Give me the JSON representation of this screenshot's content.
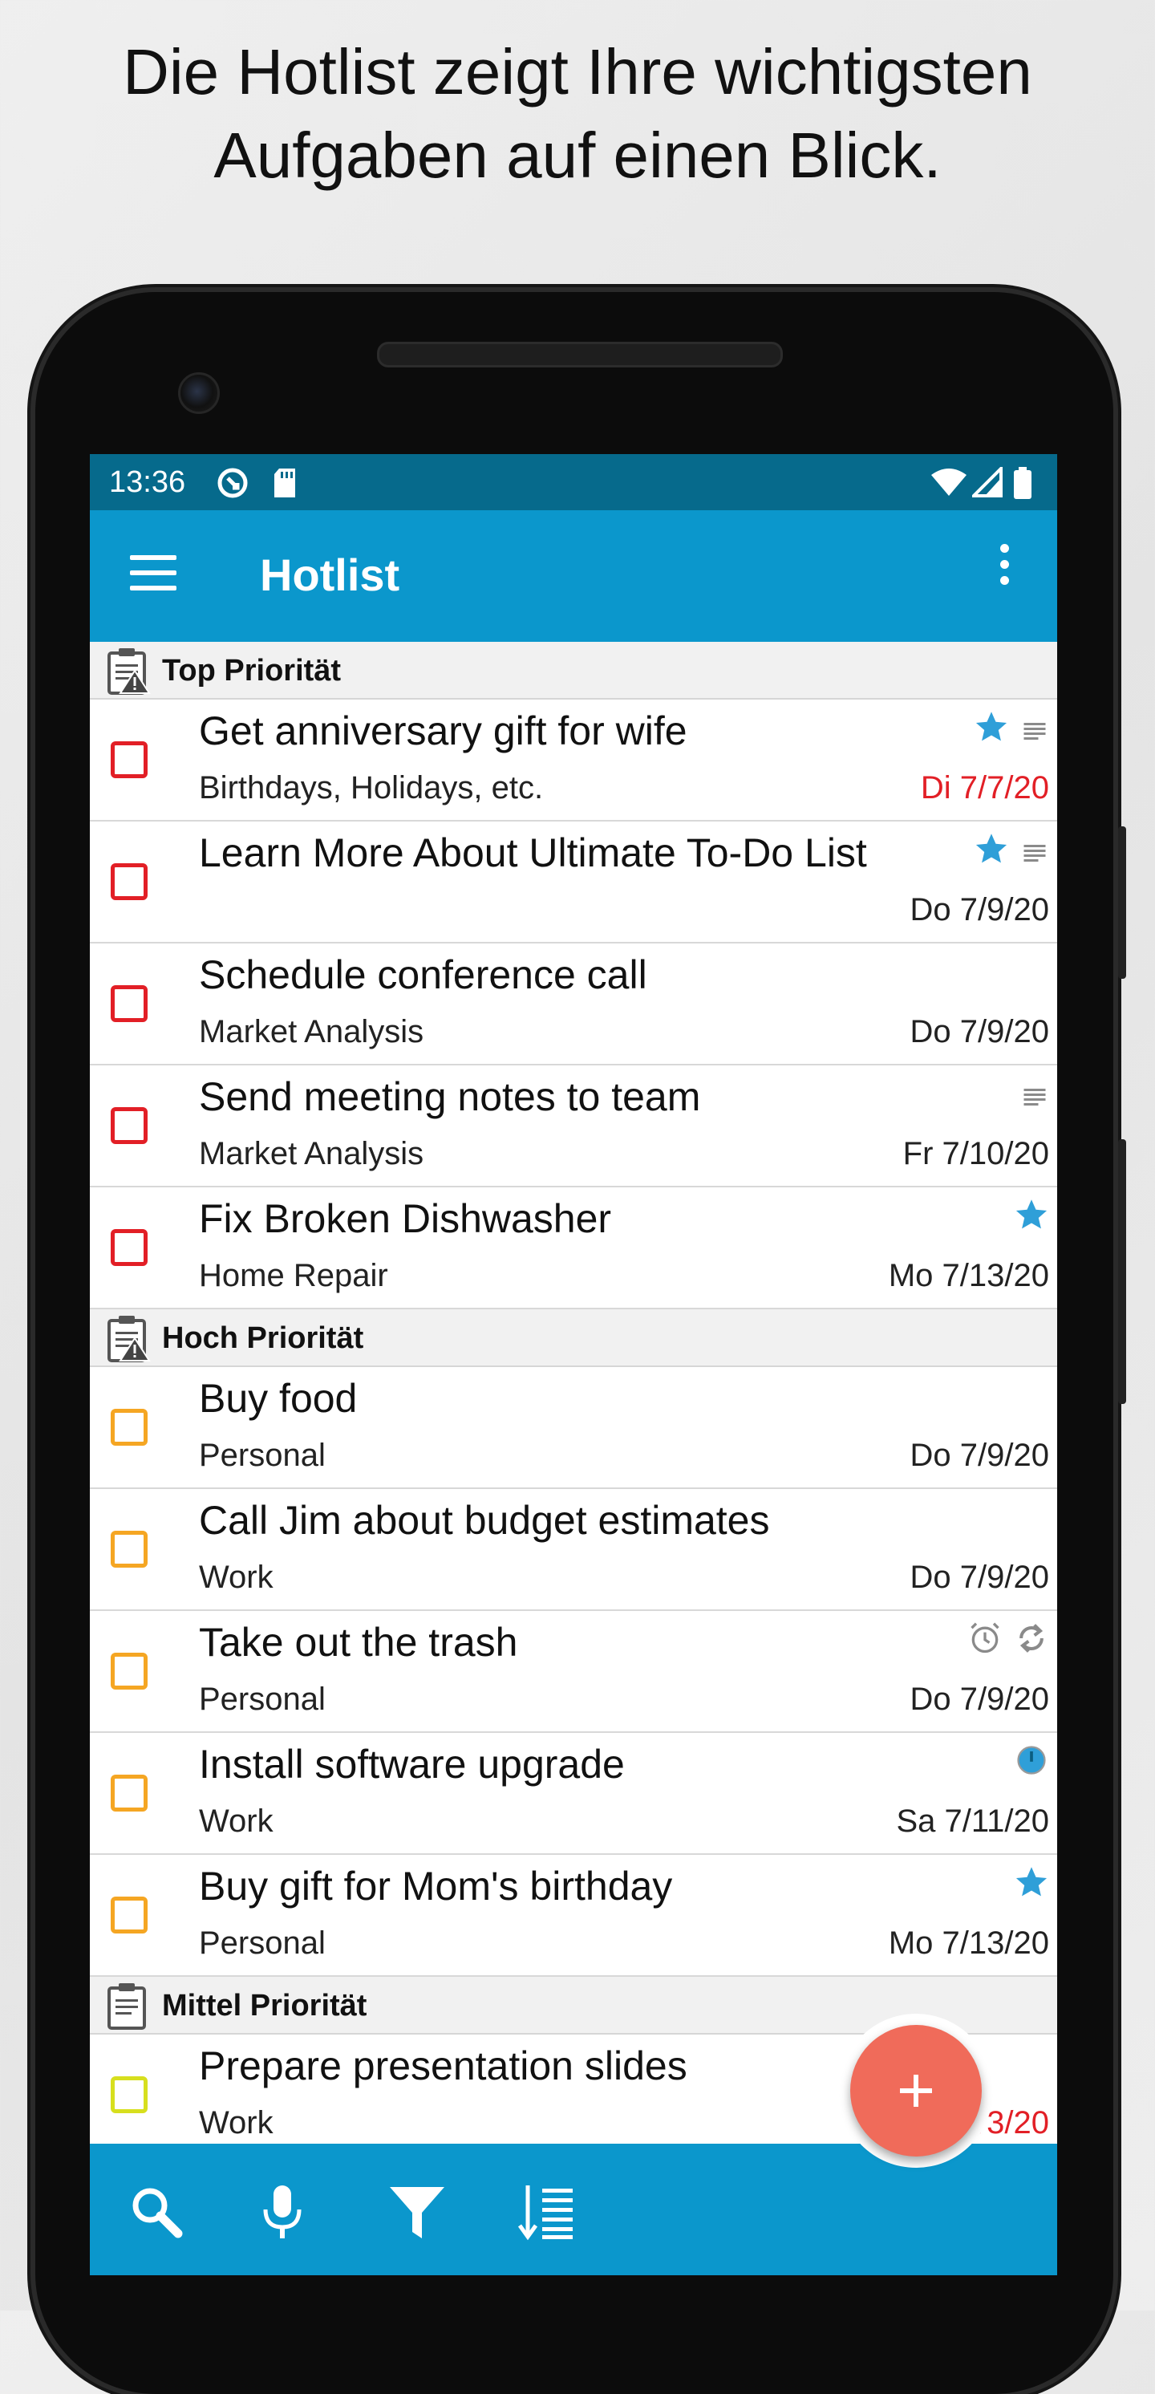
{
  "headline": {
    "line1": "Die Hotlist zeigt Ihre wichtigsten",
    "line2": "Aufgaben auf einen Blick."
  },
  "status_bar": {
    "time": "13:36",
    "icons": [
      "sync-icon",
      "sd-card-icon",
      "wifi-icon",
      "signal-icon",
      "battery-icon"
    ]
  },
  "app_bar": {
    "title": "Hotlist",
    "menu_icon": "hamburger-menu-icon",
    "overflow_icon": "more-vert-icon"
  },
  "colors": {
    "status_bar": "#066a8c",
    "app_bar": "#0b97cc",
    "priority_top": "#e21f26",
    "priority_high": "#f5a623",
    "priority_medium": "#d7df1e",
    "overdue_date": "#e21f26",
    "star": "#2f9fd8",
    "fab": "#f06b5a"
  },
  "sections": [
    {
      "label": "Top Priorität",
      "icon": "clipboard-warning-icon",
      "color": "#e21f26",
      "tasks": [
        {
          "title": "Get anniversary gift for wife",
          "subtitle": "Birthdays, Holidays, etc.",
          "date": "Di 7/7/20",
          "overdue": true,
          "icons": [
            "star",
            "note"
          ]
        },
        {
          "title": "Learn More About Ultimate To-Do List",
          "subtitle": "",
          "date": "Do 7/9/20",
          "overdue": false,
          "icons": [
            "star",
            "note"
          ]
        },
        {
          "title": "Schedule conference call",
          "subtitle": "Market Analysis",
          "date": "Do 7/9/20",
          "overdue": false,
          "icons": []
        },
        {
          "title": "Send meeting notes to team",
          "subtitle": "Market Analysis",
          "date": "Fr 7/10/20",
          "overdue": false,
          "icons": [
            "note"
          ]
        },
        {
          "title": "Fix Broken Dishwasher",
          "subtitle": "Home Repair",
          "date": "Mo 7/13/20",
          "overdue": false,
          "icons": [
            "star"
          ]
        }
      ]
    },
    {
      "label": "Hoch Priorität",
      "icon": "clipboard-warning-icon",
      "color": "#f5a623",
      "tasks": [
        {
          "title": "Buy food",
          "subtitle": "Personal",
          "date": "Do 7/9/20",
          "overdue": false,
          "icons": []
        },
        {
          "title": "Call Jim about budget estimates",
          "subtitle": "Work",
          "date": "Do 7/9/20",
          "overdue": false,
          "icons": []
        },
        {
          "title": "Take out the trash",
          "subtitle": "Personal",
          "date": "Do 7/9/20",
          "overdue": false,
          "icons": [
            "alarm",
            "repeat"
          ]
        },
        {
          "title": "Install software upgrade",
          "subtitle": "Work",
          "date": "Sa 7/11/20",
          "overdue": false,
          "icons": [
            "dot"
          ]
        },
        {
          "title": "Buy gift for Mom's birthday",
          "subtitle": "Personal",
          "date": "Mo 7/13/20",
          "overdue": false,
          "icons": [
            "star"
          ]
        }
      ]
    },
    {
      "label": "Mittel Priorität",
      "icon": "clipboard-icon",
      "color": "#d7df1e",
      "tasks": [
        {
          "title": "Prepare presentation slides",
          "subtitle": "Work",
          "date": "/3/20",
          "overdue": true,
          "icons": []
        }
      ]
    }
  ],
  "bottom_bar": {
    "icons": [
      "search-icon",
      "microphone-icon",
      "filter-icon",
      "sort-icon"
    ]
  },
  "fab": {
    "icon": "plus-icon"
  }
}
